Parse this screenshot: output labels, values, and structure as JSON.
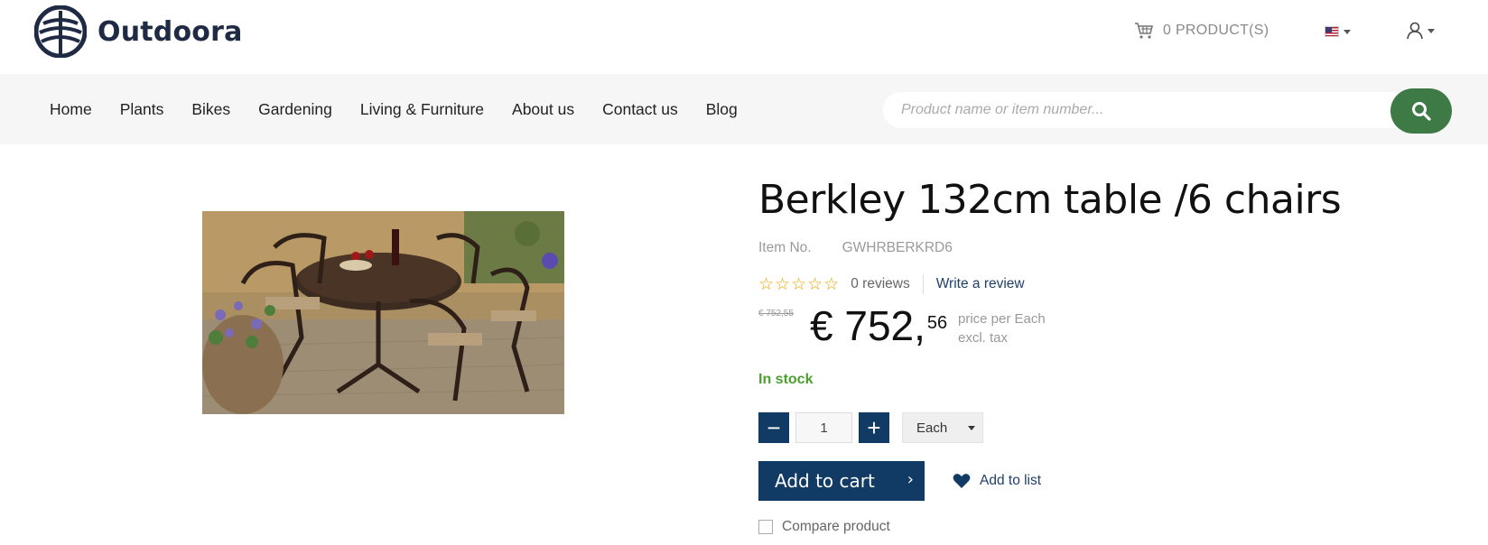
{
  "brand": {
    "name": "Outdoora"
  },
  "header": {
    "cart_label": "0 PRODUCT(S)",
    "language": "en-US"
  },
  "nav": {
    "items": [
      "Home",
      "Plants",
      "Bikes",
      "Gardening",
      "Living & Furniture",
      "About us",
      "Contact us",
      "Blog"
    ]
  },
  "search": {
    "placeholder": "Product name or item number..."
  },
  "product": {
    "title": "Berkley 132cm table /6 chairs",
    "item_no_label": "Item No.",
    "item_no": "GWHRBERKRD6",
    "stars": 0,
    "star_glyphs": [
      "☆",
      "☆",
      "☆",
      "☆",
      "☆"
    ],
    "reviews_label": "0 reviews",
    "write_review_label": "Write a review",
    "old_price": "€ 752,55",
    "price_main": "€ 752,",
    "price_cents": "56",
    "price_note_1": "price per Each",
    "price_note_2": "excl. tax",
    "stock_label": "In stock",
    "quantity": "1",
    "minus_label": "−",
    "plus_label": "+",
    "unit": "Each",
    "add_to_cart_label": "Add to cart",
    "add_to_cart_arrow": "›",
    "add_to_list_label": "Add to list",
    "compare_label": "Compare product"
  },
  "colors": {
    "primary": "#113a64",
    "search_button": "#3d7a46",
    "in_stock": "#4aa02c",
    "star": "#f0a400"
  }
}
